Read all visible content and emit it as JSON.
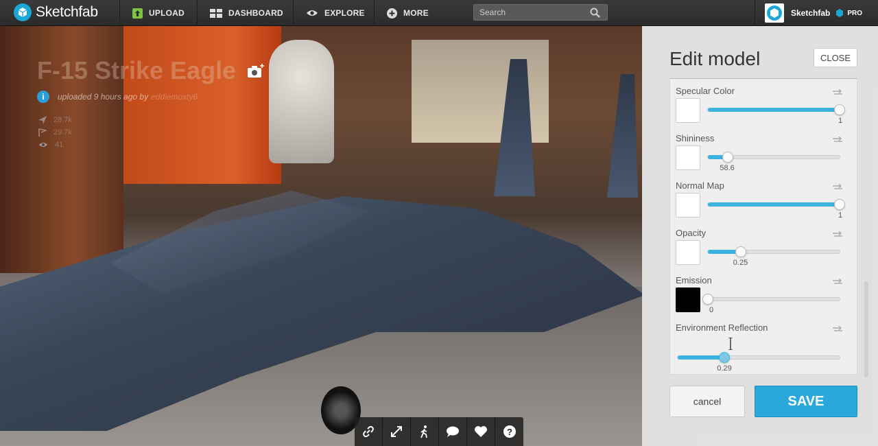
{
  "header": {
    "brand": "Sketchfab",
    "nav": [
      {
        "label": "UPLOAD",
        "icon": "upload-icon"
      },
      {
        "label": "DASHBOARD",
        "icon": "dashboard-icon"
      },
      {
        "label": "EXPLORE",
        "icon": "eye-icon"
      },
      {
        "label": "MORE",
        "icon": "plus-circle-icon"
      }
    ],
    "search_placeholder": "Search",
    "account_name": "Sketchfab",
    "account_badge": "PRO"
  },
  "model": {
    "title": "F-15 Strike Eagle",
    "uploaded": "uploaded 9 hours ago by",
    "uploader": "eddiemoxty6",
    "stats": {
      "views": "28.7k",
      "likes": "29.7k",
      "eye": "41"
    }
  },
  "viewer_toolbar": [
    "link-icon",
    "fullscreen-icon",
    "walk-icon",
    "comment-icon",
    "heart-icon",
    "help-icon"
  ],
  "panel": {
    "title": "Edit model",
    "close_label": "CLOSE",
    "properties": [
      {
        "label": "Specular Color",
        "swatch": "#ffffff",
        "value": 1,
        "value_label": "1",
        "fraction": 1.0
      },
      {
        "label": "Shininess",
        "swatch": "#ffffff",
        "value": 58.6,
        "value_label": "58.6",
        "fraction": 0.15
      },
      {
        "label": "Normal Map",
        "swatch": "#ffffff",
        "value": 1,
        "value_label": "1",
        "fraction": 1.0
      },
      {
        "label": "Opacity",
        "swatch": "#ffffff",
        "value": 0.25,
        "value_label": "0.25",
        "fraction": 0.25
      },
      {
        "label": "Emission",
        "swatch": "#000000",
        "value": 0,
        "value_label": "0",
        "fraction": 0.0
      },
      {
        "label": "Environment Reflection",
        "swatch": null,
        "value": 0.29,
        "value_label": "0.29",
        "fraction": 0.29
      }
    ],
    "cancel_label": "cancel",
    "save_label": "SAVE"
  },
  "colors": {
    "accent": "#2aa8dc",
    "slider_fill": "#3ab4de"
  }
}
